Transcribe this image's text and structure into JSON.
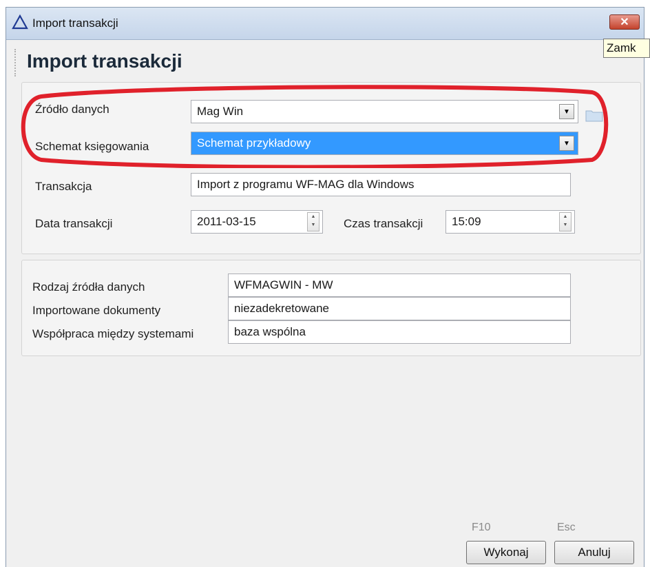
{
  "window": {
    "title": "Import transakcji"
  },
  "tooltip": "Zamk",
  "heading": "Import transakcji",
  "form": {
    "source_label": "Źródło danych",
    "source_value": "Mag Win",
    "scheme_label": "Schemat księgowania",
    "scheme_value": "Schemat przykładowy",
    "transaction_label": "Transakcja",
    "transaction_value": "Import z programu WF-MAG dla Windows",
    "date_label": "Data transakcji",
    "date_value": "2011-03-15",
    "time_label": "Czas transakcji",
    "time_value": "15:09"
  },
  "info": {
    "source_type_label": "Rodzaj źródła danych",
    "source_type_value": "WFMAGWIN - MW",
    "documents_label": "Importowane dokumenty",
    "documents_value": "niezadekretowane",
    "cooperation_label": "Współpraca między systemami",
    "cooperation_value": "baza wspólna"
  },
  "footer": {
    "execute_hint": "F10",
    "execute_label": "Wykonaj",
    "cancel_hint": "Esc",
    "cancel_label": "Anuluj"
  },
  "colors": {
    "highlight": "#e0212b",
    "selection": "#3399ff",
    "close_button": "#c4432d"
  },
  "icons": [
    "warning-triangle-icon",
    "close-icon",
    "folder-icon",
    "chevron-down-icon",
    "spin-arrows-icon"
  ]
}
